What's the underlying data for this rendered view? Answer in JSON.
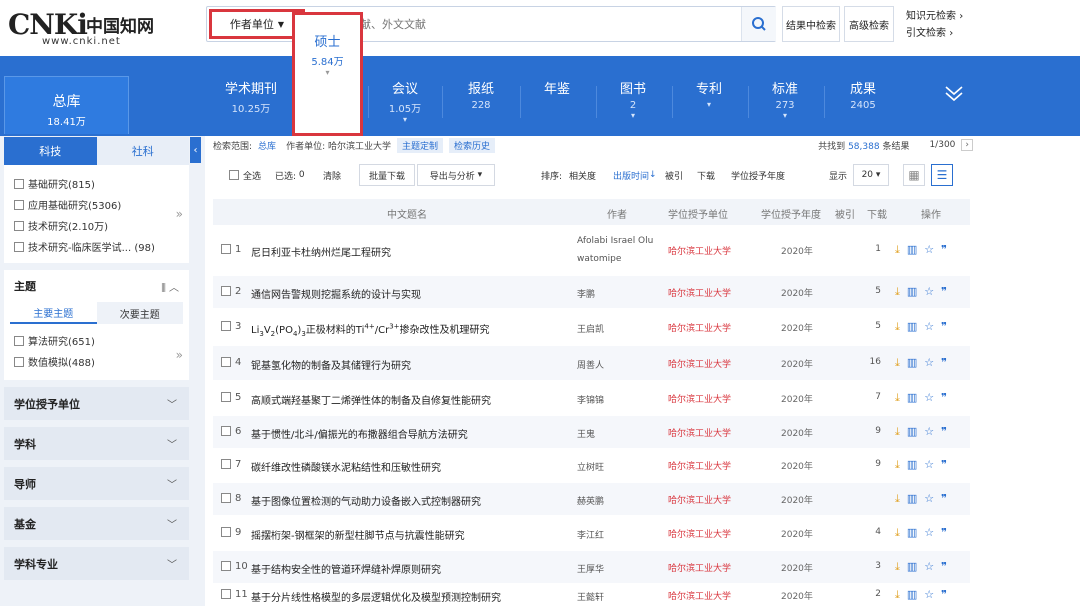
{
  "header": {
    "logo_mark": "CNKi",
    "logo_cn": "中国知网",
    "logo_url": "www.cnki.net",
    "field_select": "作者单位",
    "search_placeholder": "中文文献、外文文献",
    "search_in_results": "结果中检索",
    "advanced_search": "高级检索",
    "link_knowledge": "知识元检索",
    "link_citation": "引文检索"
  },
  "categories": {
    "total": {
      "label": "总库",
      "count": "18.41万"
    },
    "items": [
      {
        "label": "学术期刊",
        "count": "10.25万",
        "caret": ""
      },
      {
        "label": "硕士",
        "count": "5.84万",
        "caret": "▾"
      },
      {
        "label": "会议",
        "count": "1.05万",
        "caret": "▾"
      },
      {
        "label": "报纸",
        "count": "228",
        "caret": ""
      },
      {
        "label": "年鉴",
        "count": "",
        "caret": ""
      },
      {
        "label": "图书",
        "count": "2",
        "caret": "▾"
      },
      {
        "label": "专利",
        "count": "",
        "caret": "▾"
      },
      {
        "label": "标准",
        "count": "273",
        "caret": "▾"
      },
      {
        "label": "成果",
        "count": "2405",
        "caret": ""
      }
    ]
  },
  "sidebar": {
    "tab_sci": "科技",
    "tab_social": "社科",
    "filters1": [
      "基础研究(815)",
      "应用基础研究(5306)",
      "技术研究(2.10万)",
      "技术研究-临床医学试... (98)"
    ],
    "theme_title": "主题",
    "theme_tab_main": "主要主题",
    "theme_tab_sub": "次要主题",
    "filters2": [
      "算法研究(651)",
      "数值模拟(488)"
    ],
    "sections": [
      "学位授予单位",
      "学科",
      "导师",
      "基金",
      "学科专业"
    ]
  },
  "crumb": {
    "scope_label": "检索范围:",
    "scope_value": "总库",
    "query": "作者单位: 哈尔滨工业大学",
    "tag_custom": "主题定制",
    "tag_history": "检索历史",
    "found_prefix": "共找到",
    "found_count": "58,388",
    "found_suffix": "条结果",
    "page": "1/300",
    "next": "›"
  },
  "toolbar": {
    "select_all": "全选",
    "selected": "已选:",
    "selected_count": "0",
    "clear": "清除",
    "batch_download": "批量下载",
    "export": "导出与分析",
    "sort_label": "排序:",
    "sort_relevance": "相关度",
    "sort_date": "出版时间",
    "sort_cited": "被引",
    "sort_download": "下载",
    "sort_degree_year": "学位授予年度",
    "display_label": "显示",
    "display_count": "20"
  },
  "table": {
    "headers": {
      "title": "中文题名",
      "author": "作者",
      "unit": "学位授予单位",
      "year": "学位授予年度",
      "cited": "被引",
      "downloads": "下载",
      "ops": "操作"
    },
    "rows": [
      {
        "num": "1",
        "title": "尼日利亚卡杜纳州烂尾工程研究",
        "author": "Afolabi Israel Olu watomipe",
        "unit": "哈尔滨工业大学",
        "year": "2020年",
        "downloads": "1"
      },
      {
        "num": "2",
        "title": "通信网告警规则挖掘系统的设计与实现",
        "author": "李鹏",
        "unit": "哈尔滨工业大学",
        "year": "2020年",
        "downloads": "5"
      },
      {
        "num": "3",
        "title": "Li3V2(PO4)3正极材料的Ti4+/Cr3+掺杂改性及机理研究",
        "author": "王启凯",
        "unit": "哈尔滨工业大学",
        "year": "2020年",
        "downloads": "5"
      },
      {
        "num": "4",
        "title": "铌基氢化物的制备及其储锂行为研究",
        "author": "周善人",
        "unit": "哈尔滨工业大学",
        "year": "2020年",
        "downloads": "16"
      },
      {
        "num": "5",
        "title": "高顺式端羟基聚丁二烯弹性体的制备及自修复性能研究",
        "author": "李锦锦",
        "unit": "哈尔滨工业大学",
        "year": "2020年",
        "downloads": "7"
      },
      {
        "num": "6",
        "title": "基于惯性/北斗/偏振光的布撒器组合导航方法研究",
        "author": "王鬼",
        "unit": "哈尔滨工业大学",
        "year": "2020年",
        "downloads": "9"
      },
      {
        "num": "7",
        "title": "碳纤维改性磷酸镁水泥粘结性和压敏性研究",
        "author": "立树旺",
        "unit": "哈尔滨工业大学",
        "year": "2020年",
        "downloads": "9"
      },
      {
        "num": "8",
        "title": "基于图像位置检测的气动助力设备嵌入式控制器研究",
        "author": "赫英鹏",
        "unit": "哈尔滨工业大学",
        "year": "2020年",
        "downloads": ""
      },
      {
        "num": "9",
        "title": "摇摆桁架-钢框架的新型柱脚节点与抗震性能研究",
        "author": "李江红",
        "unit": "哈尔滨工业大学",
        "year": "2020年",
        "downloads": "4"
      },
      {
        "num": "10",
        "title": "基于结构安全性的管道环焊缝补焊原则研究",
        "author": "王厚华",
        "unit": "哈尔滨工业大学",
        "year": "2020年",
        "downloads": "3"
      },
      {
        "num": "11",
        "title": "基于分片线性格模型的多层逻辑优化及模型预测控制研究",
        "author": "王懿轩",
        "unit": "哈尔滨工业大学",
        "year": "2020年",
        "downloads": "2"
      }
    ]
  },
  "colors": {
    "brand_blue": "#2a6fd0",
    "highlight_red": "#d9363e"
  }
}
